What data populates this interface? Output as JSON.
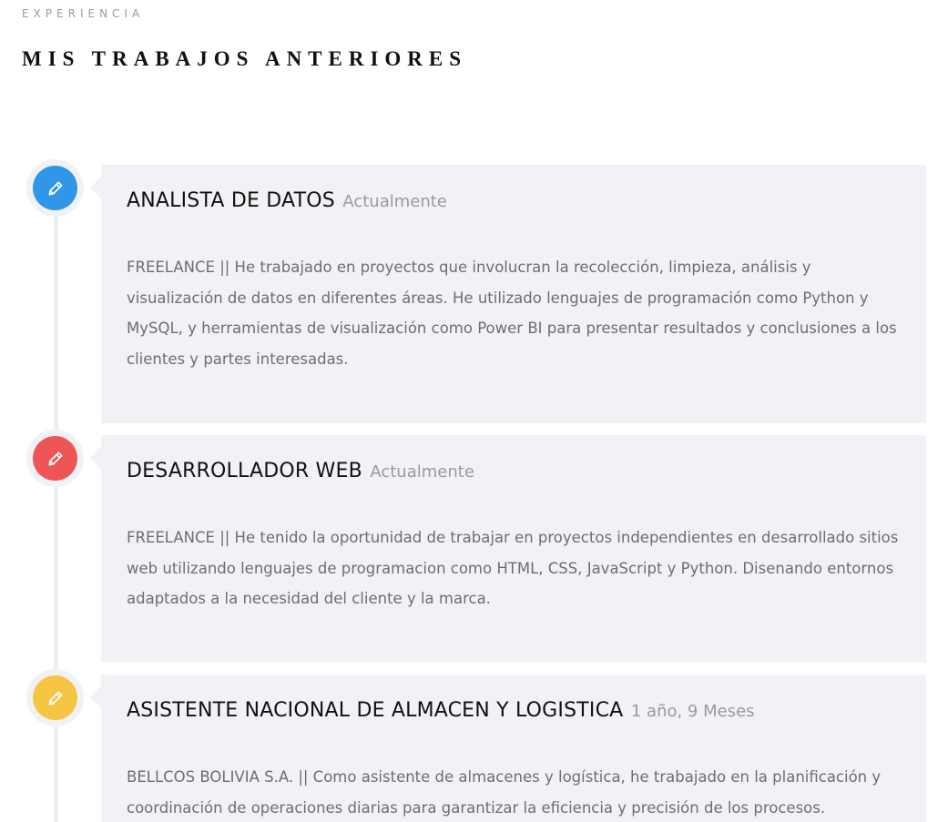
{
  "section": {
    "eyebrow": "EXPERIENCIA",
    "title": "MIS TRABAJOS ANTERIORES"
  },
  "jobs": [
    {
      "title": "ANALISTA DE DATOS",
      "period": "Actualmente",
      "description": "FREELANCE || He trabajado en proyectos que involucran la recolección, limpieza, análisis y visualización de datos en diferentes áreas. He utilizado lenguajes de programación como Python y MySQL, y herramientas de visualización como Power BI para presentar resultados y conclusiones a los clientes y partes interesadas.",
      "icon": "pencil-icon",
      "color": "#2f96e8"
    },
    {
      "title": "DESARROLLADOR WEB",
      "period": "Actualmente",
      "description": "FREELANCE || He tenido la oportunidad de trabajar en proyectos independientes en desarrollado sitios web utilizando lenguajes de programacion como HTML, CSS, JavaScript y Python. Disenando entornos adaptados a la necesidad del cliente y la marca.",
      "icon": "pencil-icon",
      "color": "#ee5556"
    },
    {
      "title": "ASISTENTE NACIONAL DE ALMACEN Y LOGISTICA",
      "period": "1 año, 9 Meses",
      "description": "BELLCOS BOLIVIA S.A. || Como asistente de almacenes y logística, he trabajado en la planificación y coordinación de operaciones diarias para garantizar la eficiencia y precisión de los procesos.",
      "icon": "pencil-icon",
      "color": "#f7c544"
    }
  ]
}
